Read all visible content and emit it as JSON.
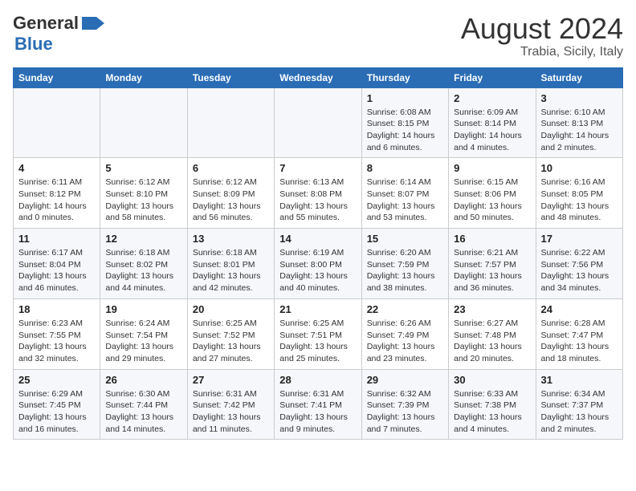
{
  "header": {
    "logo_general": "General",
    "logo_blue": "Blue",
    "title": "August 2024",
    "subtitle": "Trabia, Sicily, Italy"
  },
  "weekdays": [
    "Sunday",
    "Monday",
    "Tuesday",
    "Wednesday",
    "Thursday",
    "Friday",
    "Saturday"
  ],
  "weeks": [
    [
      {
        "day": "",
        "info": ""
      },
      {
        "day": "",
        "info": ""
      },
      {
        "day": "",
        "info": ""
      },
      {
        "day": "",
        "info": ""
      },
      {
        "day": "1",
        "info": "Sunrise: 6:08 AM\nSunset: 8:15 PM\nDaylight: 14 hours\nand 6 minutes."
      },
      {
        "day": "2",
        "info": "Sunrise: 6:09 AM\nSunset: 8:14 PM\nDaylight: 14 hours\nand 4 minutes."
      },
      {
        "day": "3",
        "info": "Sunrise: 6:10 AM\nSunset: 8:13 PM\nDaylight: 14 hours\nand 2 minutes."
      }
    ],
    [
      {
        "day": "4",
        "info": "Sunrise: 6:11 AM\nSunset: 8:12 PM\nDaylight: 14 hours\nand 0 minutes."
      },
      {
        "day": "5",
        "info": "Sunrise: 6:12 AM\nSunset: 8:10 PM\nDaylight: 13 hours\nand 58 minutes."
      },
      {
        "day": "6",
        "info": "Sunrise: 6:12 AM\nSunset: 8:09 PM\nDaylight: 13 hours\nand 56 minutes."
      },
      {
        "day": "7",
        "info": "Sunrise: 6:13 AM\nSunset: 8:08 PM\nDaylight: 13 hours\nand 55 minutes."
      },
      {
        "day": "8",
        "info": "Sunrise: 6:14 AM\nSunset: 8:07 PM\nDaylight: 13 hours\nand 53 minutes."
      },
      {
        "day": "9",
        "info": "Sunrise: 6:15 AM\nSunset: 8:06 PM\nDaylight: 13 hours\nand 50 minutes."
      },
      {
        "day": "10",
        "info": "Sunrise: 6:16 AM\nSunset: 8:05 PM\nDaylight: 13 hours\nand 48 minutes."
      }
    ],
    [
      {
        "day": "11",
        "info": "Sunrise: 6:17 AM\nSunset: 8:04 PM\nDaylight: 13 hours\nand 46 minutes."
      },
      {
        "day": "12",
        "info": "Sunrise: 6:18 AM\nSunset: 8:02 PM\nDaylight: 13 hours\nand 44 minutes."
      },
      {
        "day": "13",
        "info": "Sunrise: 6:18 AM\nSunset: 8:01 PM\nDaylight: 13 hours\nand 42 minutes."
      },
      {
        "day": "14",
        "info": "Sunrise: 6:19 AM\nSunset: 8:00 PM\nDaylight: 13 hours\nand 40 minutes."
      },
      {
        "day": "15",
        "info": "Sunrise: 6:20 AM\nSunset: 7:59 PM\nDaylight: 13 hours\nand 38 minutes."
      },
      {
        "day": "16",
        "info": "Sunrise: 6:21 AM\nSunset: 7:57 PM\nDaylight: 13 hours\nand 36 minutes."
      },
      {
        "day": "17",
        "info": "Sunrise: 6:22 AM\nSunset: 7:56 PM\nDaylight: 13 hours\nand 34 minutes."
      }
    ],
    [
      {
        "day": "18",
        "info": "Sunrise: 6:23 AM\nSunset: 7:55 PM\nDaylight: 13 hours\nand 32 minutes."
      },
      {
        "day": "19",
        "info": "Sunrise: 6:24 AM\nSunset: 7:54 PM\nDaylight: 13 hours\nand 29 minutes."
      },
      {
        "day": "20",
        "info": "Sunrise: 6:25 AM\nSunset: 7:52 PM\nDaylight: 13 hours\nand 27 minutes."
      },
      {
        "day": "21",
        "info": "Sunrise: 6:25 AM\nSunset: 7:51 PM\nDaylight: 13 hours\nand 25 minutes."
      },
      {
        "day": "22",
        "info": "Sunrise: 6:26 AM\nSunset: 7:49 PM\nDaylight: 13 hours\nand 23 minutes."
      },
      {
        "day": "23",
        "info": "Sunrise: 6:27 AM\nSunset: 7:48 PM\nDaylight: 13 hours\nand 20 minutes."
      },
      {
        "day": "24",
        "info": "Sunrise: 6:28 AM\nSunset: 7:47 PM\nDaylight: 13 hours\nand 18 minutes."
      }
    ],
    [
      {
        "day": "25",
        "info": "Sunrise: 6:29 AM\nSunset: 7:45 PM\nDaylight: 13 hours\nand 16 minutes."
      },
      {
        "day": "26",
        "info": "Sunrise: 6:30 AM\nSunset: 7:44 PM\nDaylight: 13 hours\nand 14 minutes."
      },
      {
        "day": "27",
        "info": "Sunrise: 6:31 AM\nSunset: 7:42 PM\nDaylight: 13 hours\nand 11 minutes."
      },
      {
        "day": "28",
        "info": "Sunrise: 6:31 AM\nSunset: 7:41 PM\nDaylight: 13 hours\nand 9 minutes."
      },
      {
        "day": "29",
        "info": "Sunrise: 6:32 AM\nSunset: 7:39 PM\nDaylight: 13 hours\nand 7 minutes."
      },
      {
        "day": "30",
        "info": "Sunrise: 6:33 AM\nSunset: 7:38 PM\nDaylight: 13 hours\nand 4 minutes."
      },
      {
        "day": "31",
        "info": "Sunrise: 6:34 AM\nSunset: 7:37 PM\nDaylight: 13 hours\nand 2 minutes."
      }
    ]
  ]
}
